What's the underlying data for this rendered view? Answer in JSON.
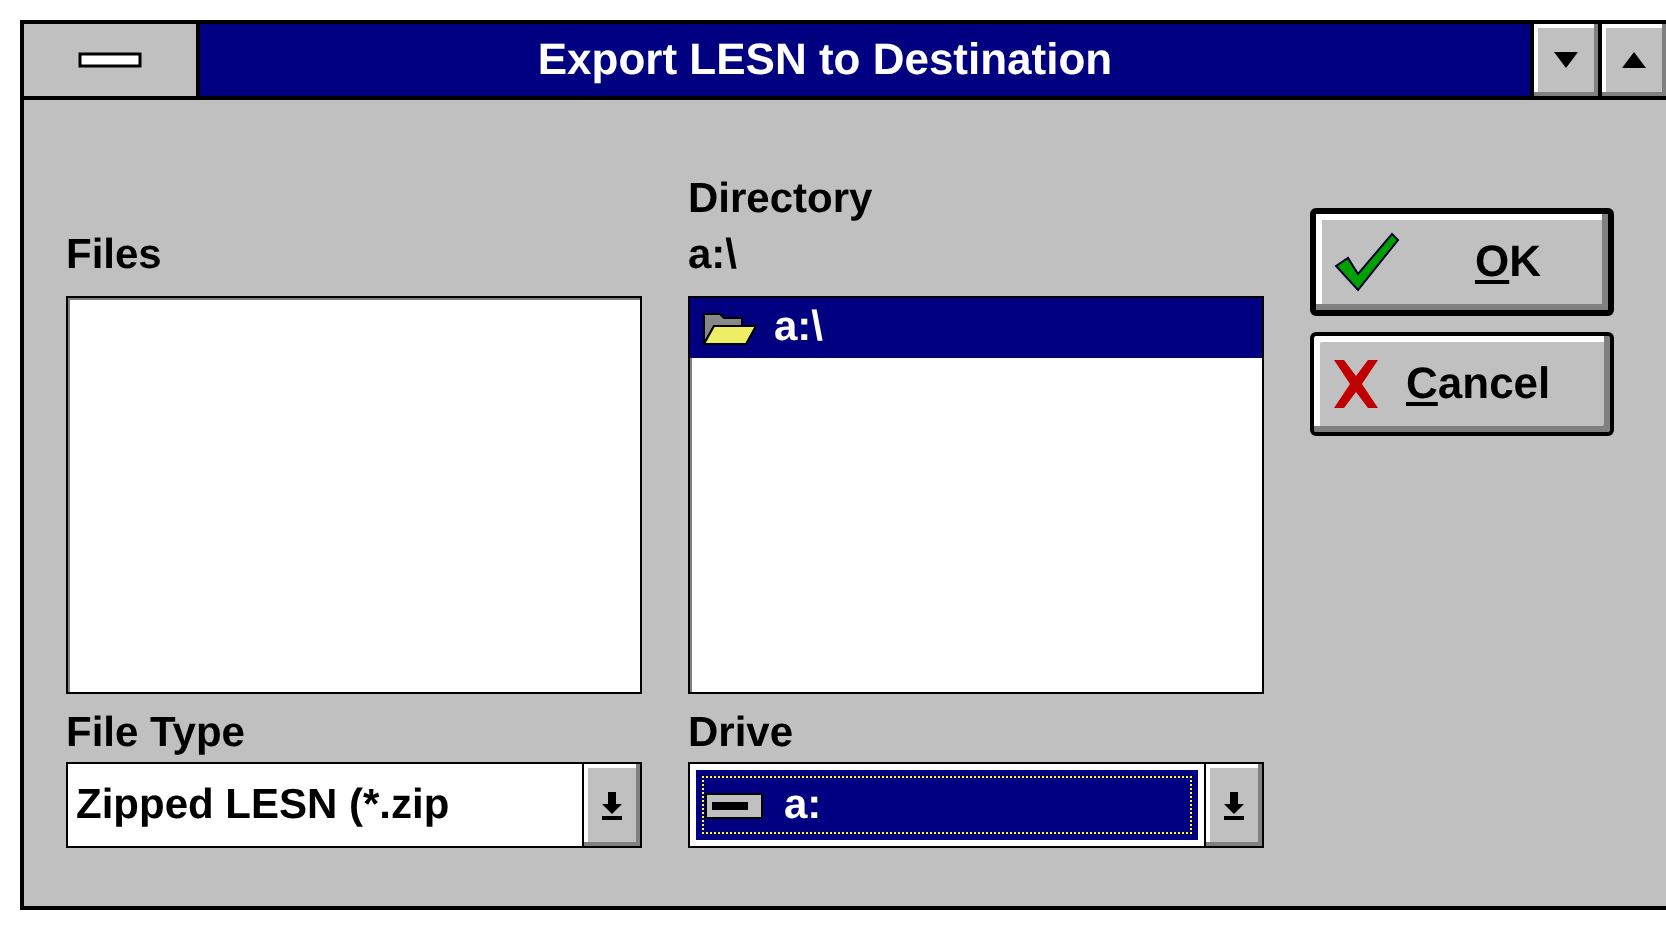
{
  "window": {
    "title": "Export LESN to Destination"
  },
  "files": {
    "label": "Files"
  },
  "directory": {
    "label": "Directory",
    "path": "a:\\",
    "items": [
      {
        "name": "a:\\",
        "selected": true
      }
    ]
  },
  "file_type": {
    "label": "File Type",
    "value": "Zipped LESN (*.zip"
  },
  "drive": {
    "label": "Drive",
    "value": "a:",
    "focused": true
  },
  "buttons": [
    {
      "kind": "ok",
      "access_key": "O",
      "label_rest": "K",
      "default": true
    },
    {
      "kind": "cancel",
      "access_key": "C",
      "label_rest": "ancel",
      "default": false
    }
  ]
}
